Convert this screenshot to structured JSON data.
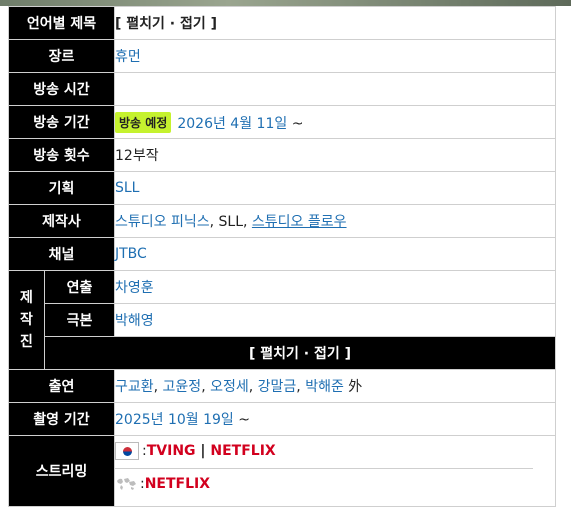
{
  "rows": {
    "lang_title": {
      "label": "언어별 제목",
      "value": "[ 펼치기 · 접기 ]"
    },
    "genre": {
      "label": "장르",
      "value": "휴먼"
    },
    "air_time": {
      "label": "방송 시간",
      "value": ""
    },
    "air_period": {
      "label": "방송 기간",
      "badge": "방송 예정",
      "date": "2026년 4월 11일",
      "suffix": " ~"
    },
    "episodes": {
      "label": "방송 횟수",
      "value": "12부작"
    },
    "planning": {
      "label": "기획",
      "value": "SLL"
    },
    "production": {
      "label": "제작사",
      "studio1": "스튜디오 피닉스",
      "sep1": ", SLL, ",
      "studio2": "스튜디오 플로우"
    },
    "channel": {
      "label": "채널",
      "value": "JTBC"
    },
    "crew": {
      "side_label": [
        "제",
        "작",
        "진"
      ],
      "director": {
        "label": "연출",
        "value": "차영훈"
      },
      "writer": {
        "label": "극본",
        "value": "박해영"
      },
      "fold": "[ 펼치기 · 접기 ]"
    },
    "cast": {
      "label": "출연",
      "names": [
        "구교환",
        "고윤정",
        "오정세",
        "강말금",
        "박해준"
      ],
      "suffix": " 外"
    },
    "filming": {
      "label": "촬영 기간",
      "date": "2025년 10월 19일",
      "suffix": " ~"
    },
    "streaming": {
      "label": "스트리밍",
      "domestic": {
        "flag_icon": "south-korea-flag-icon",
        "sep": " : ",
        "s1": "TVING",
        "bar": " | ",
        "s2": "NETFLIX"
      },
      "global": {
        "flag_icon": "world-map-icon",
        "sep": " : ",
        "s1": "NETFLIX"
      }
    }
  },
  "colors": {
    "label_bg": "#000000",
    "link": "#1f6fb2",
    "badge": "#c5f22e",
    "service_red": "#d2001e"
  }
}
